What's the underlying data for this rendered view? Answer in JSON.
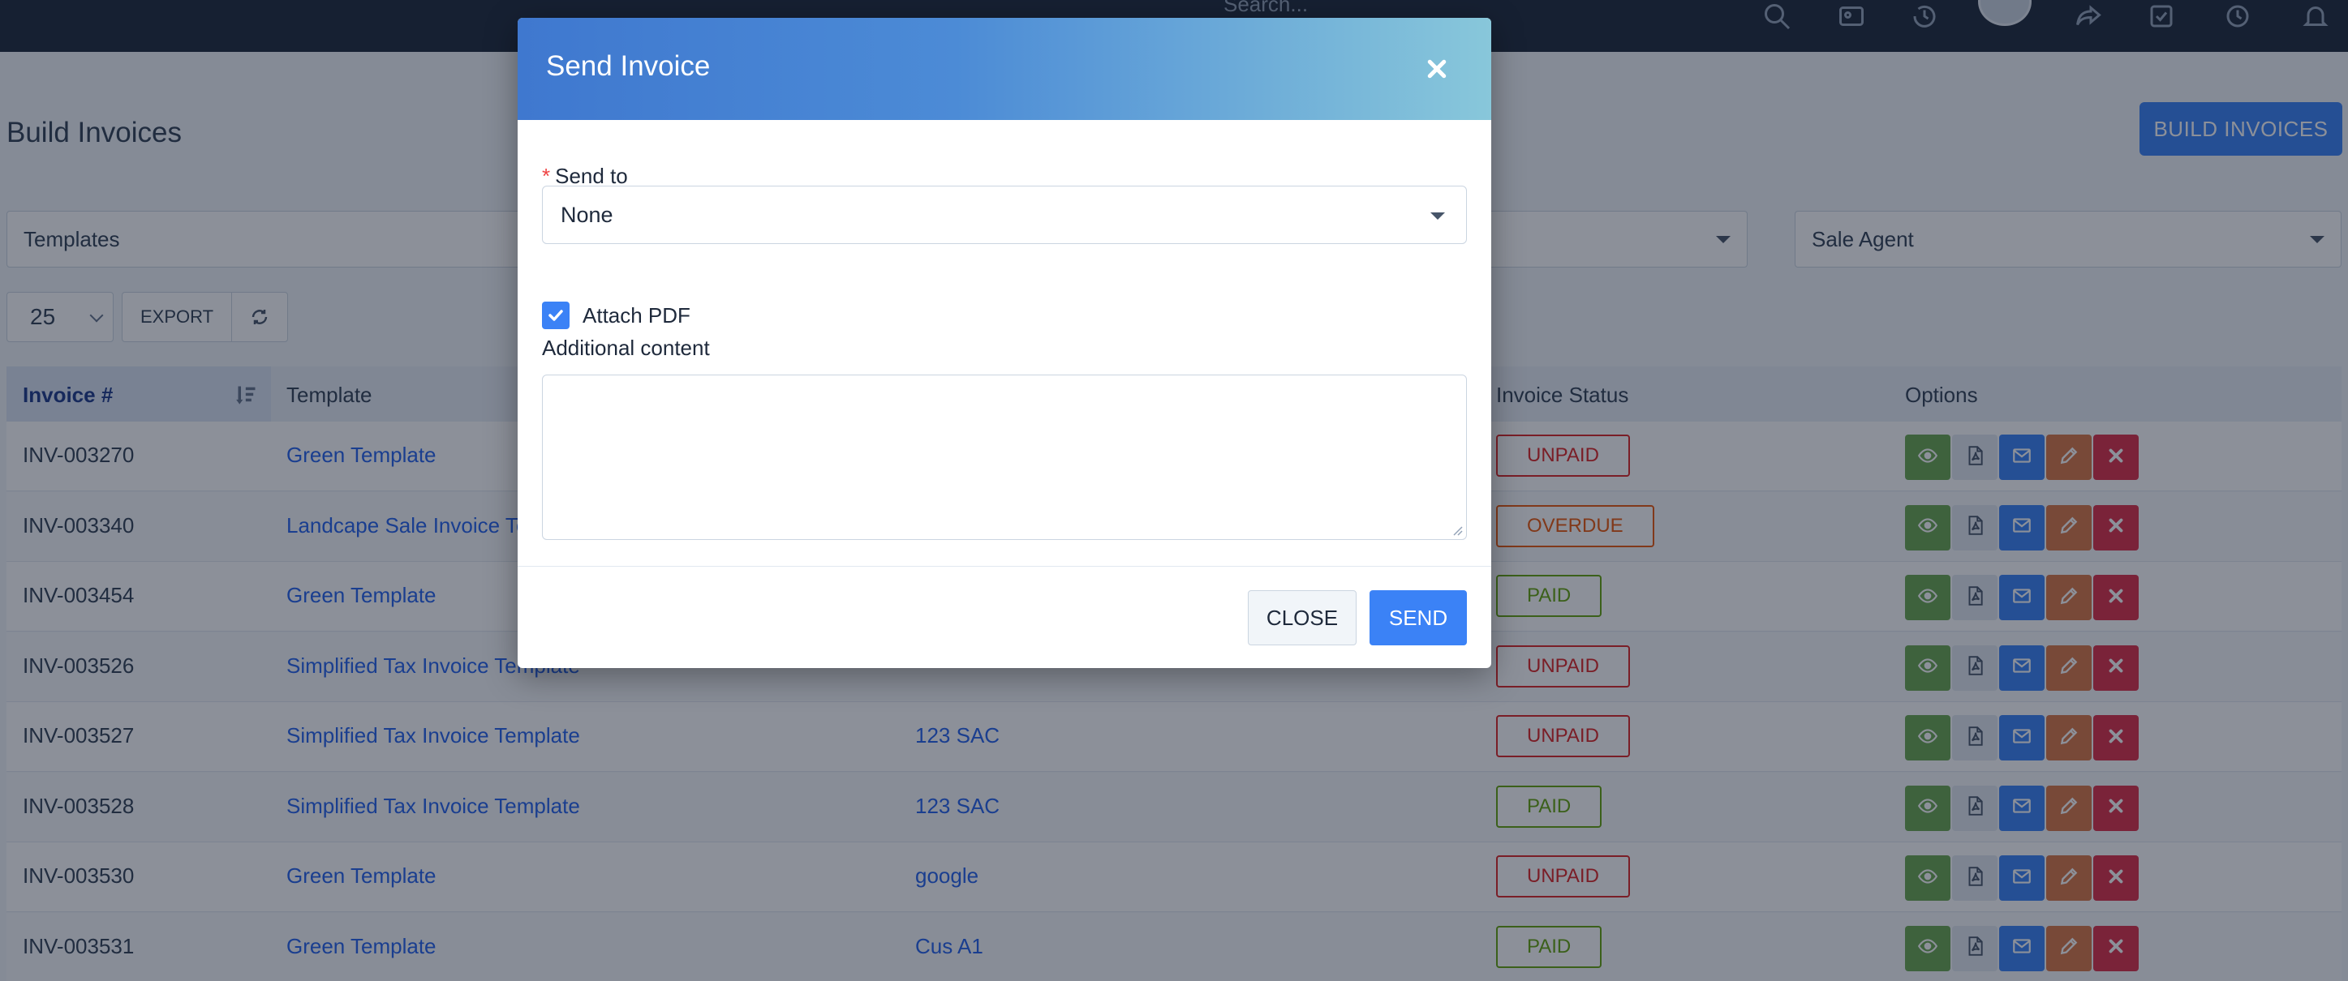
{
  "topbar": {
    "search_placeholder": "Search..."
  },
  "page": {
    "title": "Build Invoices",
    "build_button": "BUILD INVOICES",
    "filters": {
      "templates": "Templates",
      "sale_agent": "Sale Agent"
    },
    "page_size": "25",
    "export_label": "EXPORT"
  },
  "table": {
    "columns": {
      "invoice": "Invoice #",
      "template": "Template",
      "status": "Invoice Status",
      "options": "Options"
    },
    "rows": [
      {
        "invoice": "INV-003270",
        "template": "Green Template",
        "customer": "",
        "status": "UNPAID"
      },
      {
        "invoice": "INV-003340",
        "template": "Landcape Sale Invoice Te",
        "customer": "",
        "status": "OVERDUE"
      },
      {
        "invoice": "INV-003454",
        "template": "Green Template",
        "customer": "",
        "status": "PAID"
      },
      {
        "invoice": "INV-003526",
        "template": "Simplified Tax Invoice Template",
        "customer": "",
        "status": "UNPAID"
      },
      {
        "invoice": "INV-003527",
        "template": "Simplified Tax Invoice Template",
        "customer": "123 SAC",
        "status": "UNPAID"
      },
      {
        "invoice": "INV-003528",
        "template": "Simplified Tax Invoice Template",
        "customer": "123 SAC",
        "status": "PAID"
      },
      {
        "invoice": "INV-003530",
        "template": "Green Template",
        "customer": "google",
        "status": "UNPAID"
      },
      {
        "invoice": "INV-003531",
        "template": "Green Template",
        "customer": "Cus A1",
        "status": "PAID"
      }
    ]
  },
  "modal": {
    "title": "Send Invoice",
    "send_to_label": "Send to",
    "required_mark": "*",
    "send_to_value": "None",
    "attach_pdf_label": "Attach PDF",
    "attach_pdf_checked": true,
    "additional_content_label": "Additional content",
    "close_label": "CLOSE",
    "send_label": "SEND"
  },
  "colors": {
    "primary": "#3b82f6",
    "unpaid": "#dc2626",
    "overdue": "#ea580c",
    "paid": "#65a30d",
    "view_btn": "#6aa84f",
    "mail_btn": "#3b82f6",
    "edit_btn": "#d97745",
    "delete_btn": "#dc2f48"
  }
}
